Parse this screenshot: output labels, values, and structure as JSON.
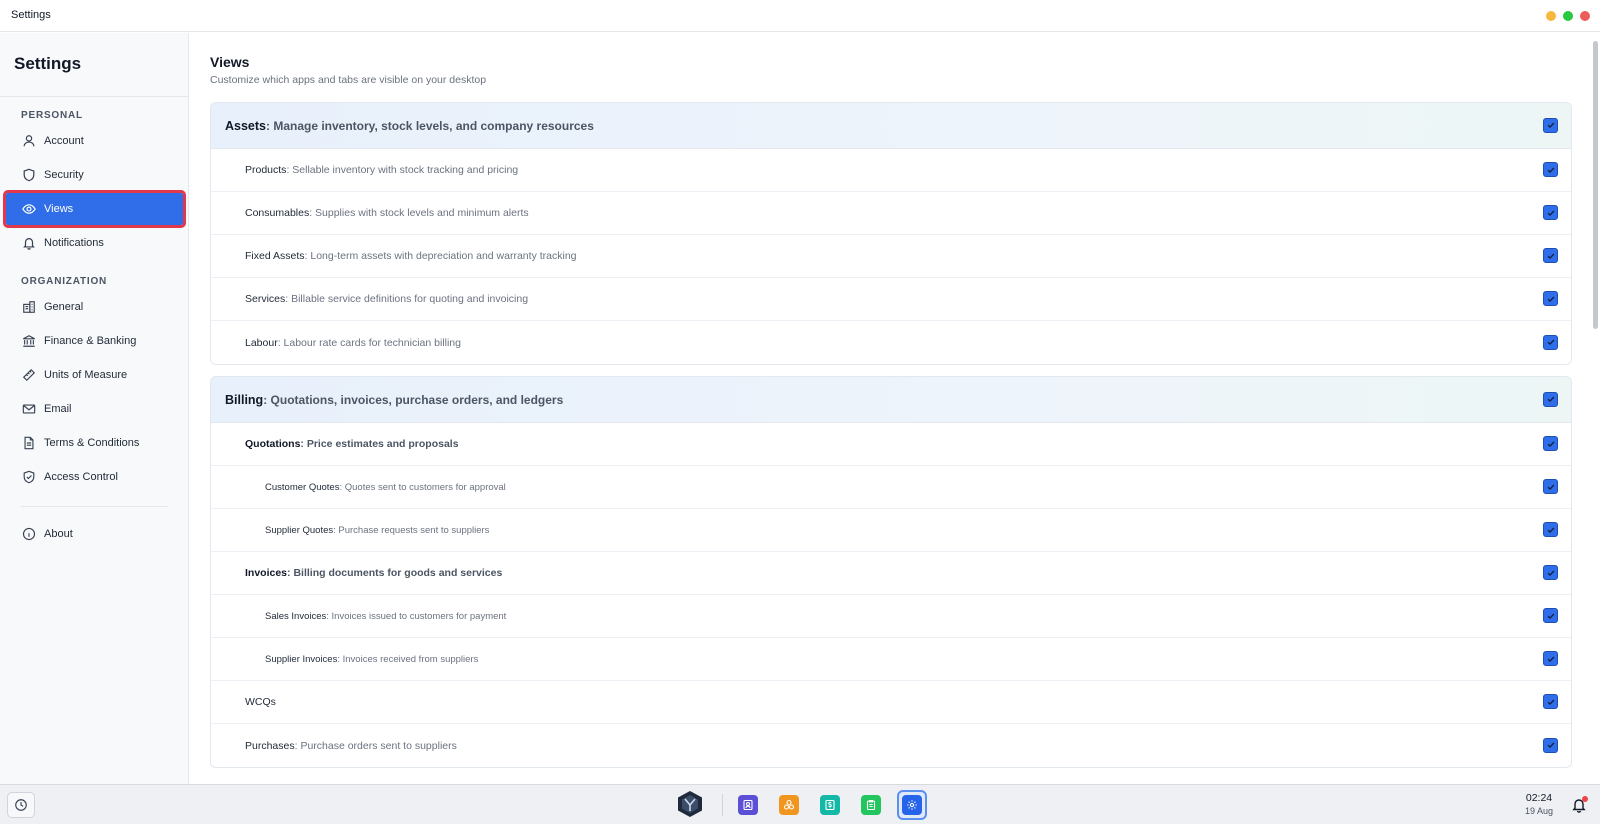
{
  "window": {
    "title": "Settings"
  },
  "sidebar": {
    "heading": "Settings",
    "personal_label": "PERSONAL",
    "organization_label": "ORGANIZATION",
    "items": [
      {
        "label": "Account",
        "icon": "user-icon"
      },
      {
        "label": "Security",
        "icon": "shield-icon"
      },
      {
        "label": "Views",
        "icon": "eye-icon",
        "active": true
      },
      {
        "label": "Notifications",
        "icon": "bell-icon"
      },
      {
        "label": "General",
        "icon": "building-icon"
      },
      {
        "label": "Finance & Banking",
        "icon": "bank-icon"
      },
      {
        "label": "Units of Measure",
        "icon": "ruler-icon"
      },
      {
        "label": "Email",
        "icon": "mail-icon"
      },
      {
        "label": "Terms & Conditions",
        "icon": "document-icon"
      },
      {
        "label": "Access Control",
        "icon": "shield-check-icon"
      },
      {
        "label": "About",
        "icon": "info-icon"
      }
    ]
  },
  "main": {
    "title": "Views",
    "subtitle": "Customize which apps and tabs are visible on your desktop",
    "groups": [
      {
        "title": "Assets",
        "description": ": Manage inventory, stock levels, and company resources",
        "checked": true,
        "rows": [
          {
            "title": "Products",
            "description": ": Sellable inventory with stock tracking and pricing",
            "checked": true
          },
          {
            "title": "Consumables",
            "description": ": Supplies with stock levels and minimum alerts",
            "checked": true
          },
          {
            "title": "Fixed Assets",
            "description": ": Long-term assets with depreciation and warranty tracking",
            "checked": true
          },
          {
            "title": "Services",
            "description": ": Billable service definitions for quoting and invoicing",
            "checked": true
          },
          {
            "title": "Labour",
            "description": ": Labour rate cards for technician billing",
            "checked": true
          }
        ]
      },
      {
        "title": "Billing",
        "description": ": Quotations, invoices, purchase orders, and ledgers",
        "checked": true,
        "rows": [
          {
            "title": "Quotations",
            "description": ": Price estimates and proposals",
            "checked": true
          },
          {
            "title": "Customer Quotes",
            "description": ": Quotes sent to customers for approval",
            "checked": true
          },
          {
            "title": "Supplier Quotes",
            "description": ": Purchase requests sent to suppliers",
            "checked": true
          },
          {
            "title": "Invoices",
            "description": ": Billing documents for goods and services",
            "checked": true
          },
          {
            "title": "Sales Invoices",
            "description": ": Invoices issued to customers for payment",
            "checked": true
          },
          {
            "title": "Supplier Invoices",
            "description": ": Invoices received from suppliers",
            "checked": true
          },
          {
            "title": "WCQs",
            "description": "",
            "checked": true
          },
          {
            "title": "Purchases",
            "description": ": Purchase orders sent to suppliers",
            "checked": true
          }
        ]
      }
    ]
  },
  "taskbar": {
    "time": "02:24",
    "date": "19 Aug",
    "apps": [
      {
        "name": "contacts-app-icon",
        "color": "#5b4fd6"
      },
      {
        "name": "assets-app-icon",
        "color": "#f0961f"
      },
      {
        "name": "billing-app-icon",
        "color": "#14b8a6"
      },
      {
        "name": "tasks-app-icon",
        "color": "#22c55e"
      },
      {
        "name": "settings-app-icon",
        "color": "#2563eb",
        "active": true
      }
    ]
  },
  "colors": {
    "accent": "#2f6ee8",
    "highlight_outline": "#e0394b"
  }
}
